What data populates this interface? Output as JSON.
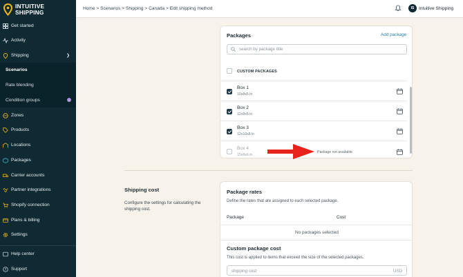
{
  "brand": {
    "line1": "INTUITIVE",
    "line2": "SHIPPING"
  },
  "sidebar": {
    "items": [
      {
        "label": "Get started",
        "icon": "dashboard-icon"
      },
      {
        "label": "Activity",
        "icon": "activity-icon"
      },
      {
        "label": "Shipping",
        "icon": "pin-icon"
      },
      {
        "label": "Zones",
        "icon": "globe-icon"
      },
      {
        "label": "Products",
        "icon": "tag-icon"
      },
      {
        "label": "Locations",
        "icon": "warehouse-icon"
      },
      {
        "label": "Packages",
        "icon": "box-icon"
      },
      {
        "label": "Carrier accounts",
        "icon": "truck-icon"
      },
      {
        "label": "Partner integrations",
        "icon": "handshake-icon"
      },
      {
        "label": "Shopify connection",
        "icon": "cart-icon"
      },
      {
        "label": "Plans & billing",
        "icon": "card-icon"
      },
      {
        "label": "Settings",
        "icon": "gear-icon"
      },
      {
        "label": "Help center",
        "icon": "help-icon"
      },
      {
        "label": "Support",
        "icon": "support-icon"
      }
    ],
    "shipping_sub": [
      {
        "label": "Scenarios",
        "active": true
      },
      {
        "label": "Rate blending",
        "active": false
      },
      {
        "label": "Condition groups",
        "active": false,
        "badge": "i"
      }
    ]
  },
  "topbar": {
    "breadcrumb": "Home > Scenarios > Shipping > Canada > Edit shipping method",
    "avatar_initials": "IS",
    "account_name": "Intuitive Shipping"
  },
  "packages": {
    "title": "Packages",
    "add_label": "Add package",
    "search_placeholder": "search by package title",
    "column_header": "CUSTOM PACKAGES",
    "rows": [
      {
        "name": "Box 1",
        "dims": "10x8x5 in",
        "checked": true
      },
      {
        "name": "Box 2",
        "dims": "12x8x5 in",
        "checked": true
      },
      {
        "name": "Box 3",
        "dims": "12x10x8 in",
        "checked": true
      },
      {
        "name": "Box 4",
        "dims": "15x8x6 in",
        "checked": false,
        "note": "Package not available"
      }
    ]
  },
  "shipping_cost": {
    "title": "Shipping cost",
    "description": "Configure the settings for calculating the shipping cost."
  },
  "rates": {
    "title": "Package rates",
    "description": "Define the rates that are assigned to each selected package.",
    "col_package": "Package",
    "col_cost": "Cost",
    "empty": "No packages selected",
    "custom_title": "Custom package cost",
    "custom_description": "This cost is applied to items that exceed the size of the selected packages.",
    "cost_placeholder": "shipping cost",
    "currency": "USD"
  },
  "colors": {
    "sidebar": "#0f2a33",
    "page": "#f7f3ea",
    "link": "#2a7fa0",
    "arrow": "#e8231b"
  }
}
